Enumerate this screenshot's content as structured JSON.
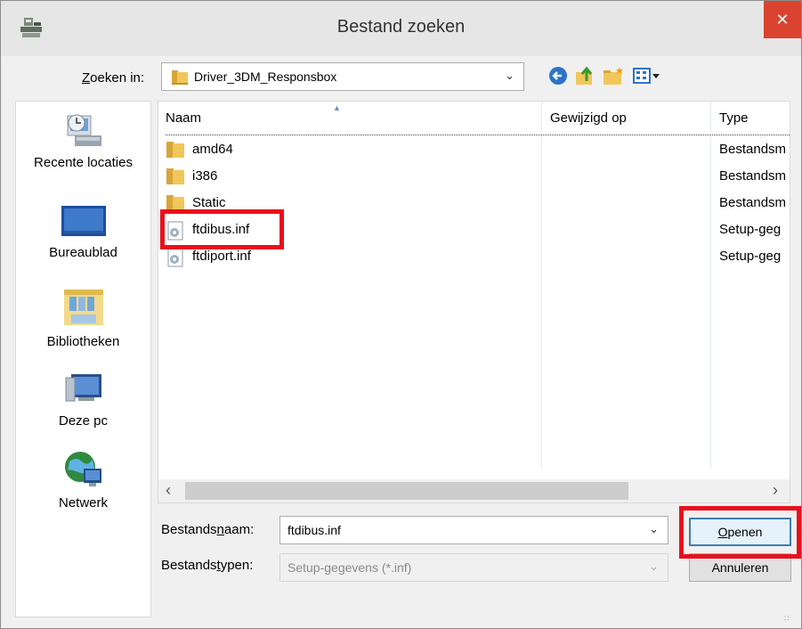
{
  "window": {
    "title": "Bestand zoeken",
    "close_label": "✕"
  },
  "lookin": {
    "label_prefix": "",
    "label_accel": "Z",
    "label_rest": "oeken in:",
    "value": "Driver_3DM_Responsbox"
  },
  "places": [
    {
      "label": "Recente locaties",
      "icon": "recent-places-icon"
    },
    {
      "label": "Bureaublad",
      "icon": "desktop-icon"
    },
    {
      "label": "Bibliotheken",
      "icon": "libraries-icon"
    },
    {
      "label": "Deze pc",
      "icon": "computer-icon"
    },
    {
      "label": "Netwerk",
      "icon": "network-icon"
    }
  ],
  "columns": {
    "name": "Naam",
    "modified": "Gewijzigd op",
    "type": "Type"
  },
  "files": [
    {
      "name": "amd64",
      "type": "Bestandsm",
      "icon": "folder-icon"
    },
    {
      "name": "i386",
      "type": "Bestandsm",
      "icon": "folder-icon"
    },
    {
      "name": "Static",
      "type": "Bestandsm",
      "icon": "folder-icon"
    },
    {
      "name": "ftdibus.inf",
      "type": "Setup-geg",
      "icon": "setup-file-icon"
    },
    {
      "name": "ftdiport.inf",
      "type": "Setup-geg",
      "icon": "setup-file-icon"
    }
  ],
  "filename": {
    "label_pre": "Bestands",
    "label_accel": "n",
    "label_post": "aam:",
    "value": "ftdibus.inf"
  },
  "filetype": {
    "label_pre": "Bestands",
    "label_accel": "t",
    "label_post": "ypen:",
    "value": "Setup-gegevens (*.inf)"
  },
  "buttons": {
    "open_accel": "O",
    "open_rest": "penen",
    "cancel": "Annuleren"
  },
  "colors": {
    "highlight": "#e8101c",
    "close": "#d9432f",
    "folder": "#e8b84a"
  }
}
